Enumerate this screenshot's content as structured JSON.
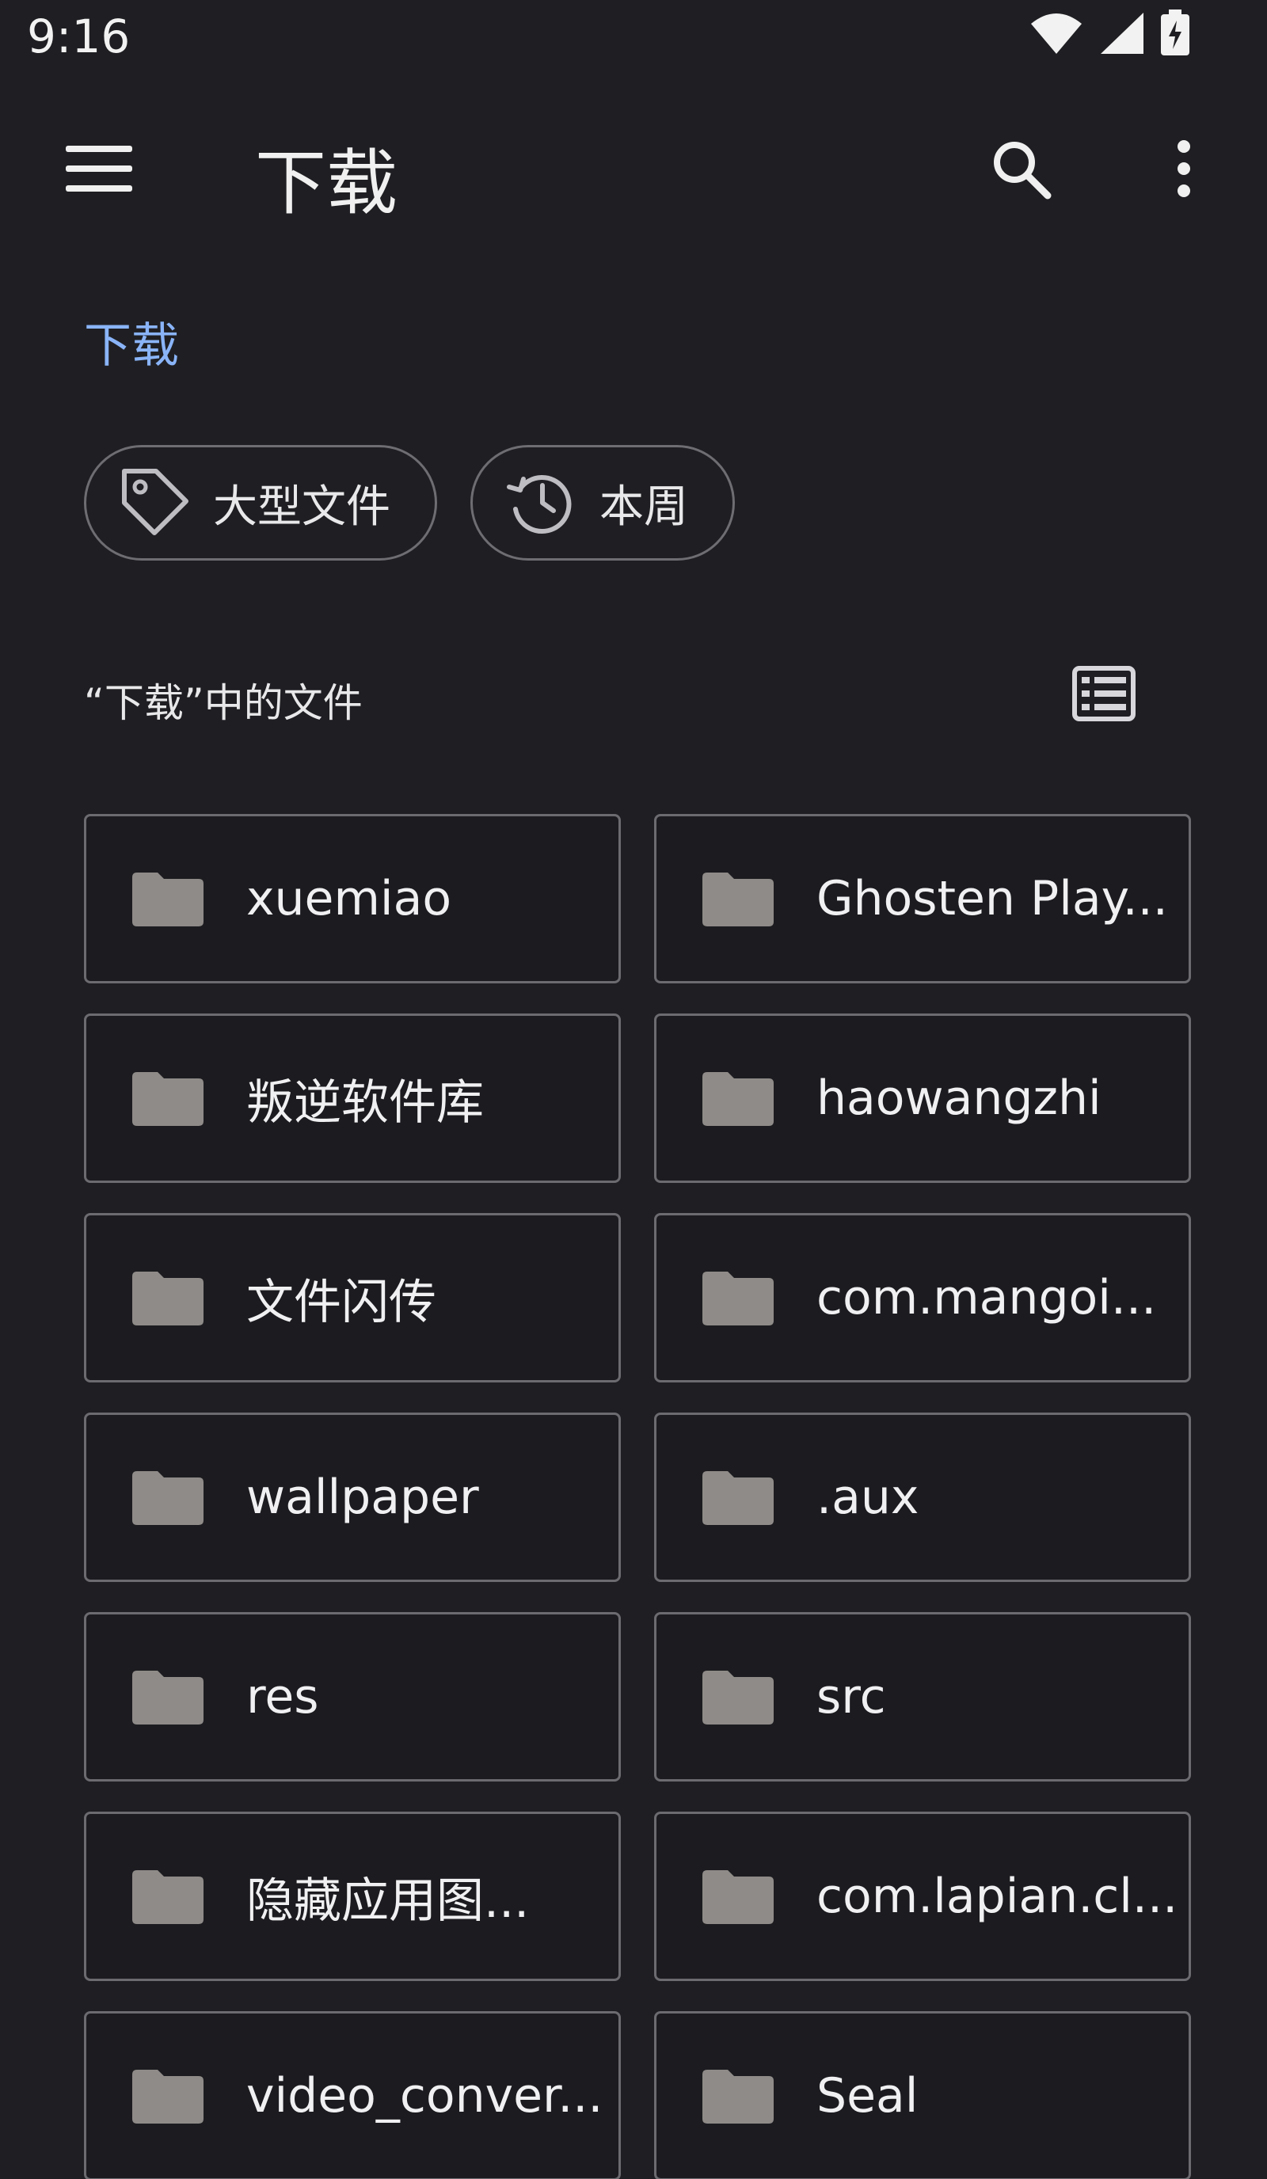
{
  "status_bar": {
    "time": "9:16",
    "icons": [
      "wifi-icon",
      "cellular-signal-icon",
      "battery-charging-icon"
    ]
  },
  "app_bar": {
    "title": "下载",
    "icons": [
      "menu-icon",
      "search-icon",
      "more-vert-icon"
    ]
  },
  "breadcrumb": "下载",
  "chips": [
    {
      "label": "大型文件",
      "icon": "tag-icon"
    },
    {
      "label": "本周",
      "icon": "history-icon"
    }
  ],
  "section": {
    "title": "“下载”中的文件",
    "view_icon": "list-view-icon"
  },
  "folders": [
    {
      "name": "xuemiao"
    },
    {
      "name": "Ghosten Play..."
    },
    {
      "name": "叛逆软件库"
    },
    {
      "name": "haowangzhi"
    },
    {
      "name": "文件闪传"
    },
    {
      "name": "com.mangoi..."
    },
    {
      "name": "wallpaper"
    },
    {
      "name": ".aux"
    },
    {
      "name": "res"
    },
    {
      "name": "src"
    },
    {
      "name": "隐藏应用图..."
    },
    {
      "name": "com.lapian.cl..."
    },
    {
      "name": "video_conver..."
    },
    {
      "name": "Seal"
    }
  ],
  "colors": {
    "background": "#1f1f23",
    "accent": "#8ab4f8",
    "folder_icon": "#8f8b88",
    "border": "#6b6b70"
  }
}
